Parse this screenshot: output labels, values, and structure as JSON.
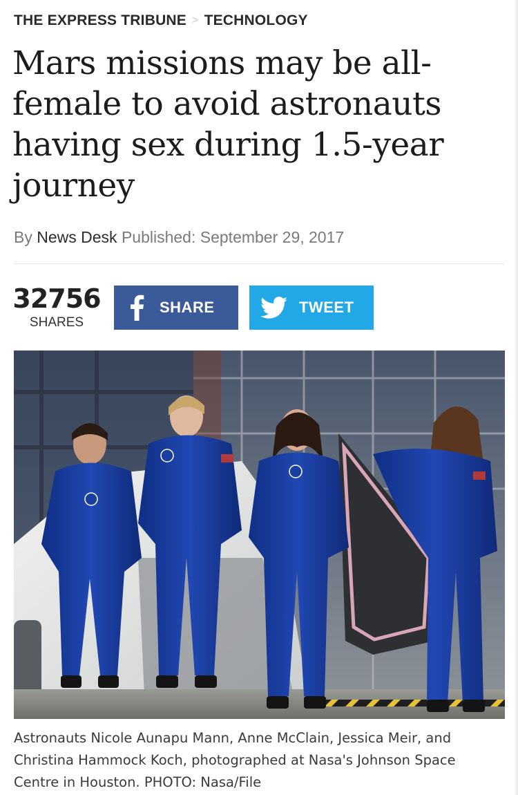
{
  "breadcrumb": {
    "site": "THE EXPRESS TRIBUNE",
    "separator": ">",
    "section": "TECHNOLOGY"
  },
  "article": {
    "headline": "Mars missions may be all-female to avoid astronauts having sex during 1.5-year journey",
    "byline_prefix": "By",
    "author": "News Desk",
    "published_label": "Published:",
    "published_date": "September 29, 2017"
  },
  "share": {
    "count": "32756",
    "count_label": "SHARES",
    "facebook_label": "SHARE",
    "twitter_label": "TWEET",
    "facebook_icon": "facebook-f-icon",
    "twitter_icon": "twitter-bird-icon",
    "facebook_color": "#3b5a99",
    "twitter_color": "#22a7e7"
  },
  "photo": {
    "caption": "Astronauts Nicole Aunapu Mann, Anne McClain, Jessica Meir, and Christina Hammock Koch, photographed at Nasa's Johnson Space Centre in Houston. PHOTO: Nasa/File"
  }
}
